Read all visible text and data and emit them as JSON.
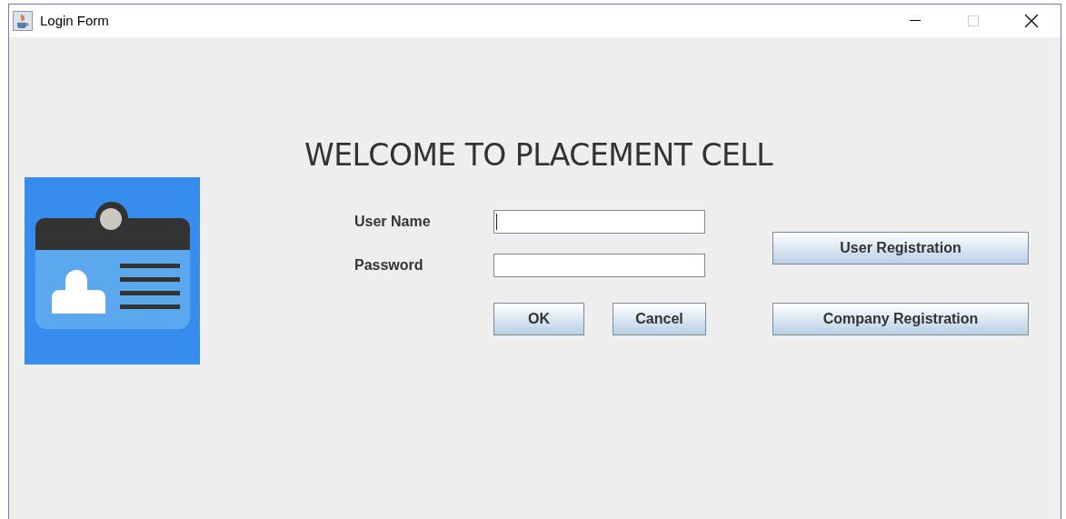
{
  "window": {
    "title": "Login Form",
    "maximize_disabled": true
  },
  "heading": "WELCOME TO PLACEMENT CELL",
  "fields": [
    {
      "label": "User Name",
      "focused": true
    },
    {
      "label": "Password",
      "focused": false
    }
  ],
  "form_buttons": [
    "OK",
    "Cancel"
  ],
  "side_buttons": [
    "User Registration",
    "Company Registration"
  ]
}
